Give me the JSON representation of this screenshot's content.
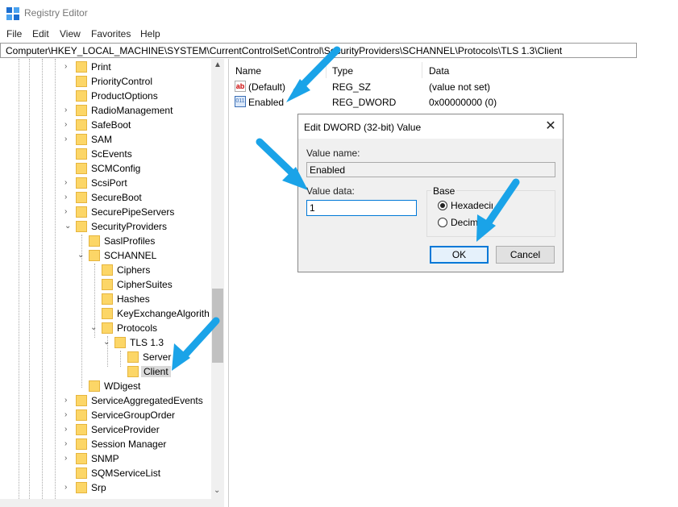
{
  "window": {
    "title": "Registry Editor"
  },
  "menu": [
    "File",
    "Edit",
    "View",
    "Favorites",
    "Help"
  ],
  "address": "Computer\\HKEY_LOCAL_MACHINE\\SYSTEM\\CurrentControlSet\\Control\\SecurityProviders\\SCHANNEL\\Protocols\\TLS 1.3\\Client",
  "tree": [
    {
      "label": "Print",
      "arrow": "›"
    },
    {
      "label": "PriorityControl",
      "arrow": ""
    },
    {
      "label": "ProductOptions",
      "arrow": ""
    },
    {
      "label": "RadioManagement",
      "arrow": "›"
    },
    {
      "label": "SafeBoot",
      "arrow": "›"
    },
    {
      "label": "SAM",
      "arrow": "›"
    },
    {
      "label": "ScEvents",
      "arrow": ""
    },
    {
      "label": "SCMConfig",
      "arrow": ""
    },
    {
      "label": "ScsiPort",
      "arrow": "›"
    },
    {
      "label": "SecureBoot",
      "arrow": "›"
    },
    {
      "label": "SecurePipeServers",
      "arrow": "›"
    },
    {
      "label": "SecurityProviders",
      "arrow": "⌄"
    },
    {
      "label": "SaslProfiles",
      "arrow": ""
    },
    {
      "label": "SCHANNEL",
      "arrow": "⌄"
    },
    {
      "label": "Ciphers",
      "arrow": ""
    },
    {
      "label": "CipherSuites",
      "arrow": ""
    },
    {
      "label": "Hashes",
      "arrow": ""
    },
    {
      "label": "KeyExchangeAlgorith",
      "arrow": ""
    },
    {
      "label": "Protocols",
      "arrow": "⌄"
    },
    {
      "label": "TLS 1.3",
      "arrow": "⌄"
    },
    {
      "label": "Server",
      "arrow": ""
    },
    {
      "label": "Client",
      "arrow": ""
    },
    {
      "label": "WDigest",
      "arrow": ""
    },
    {
      "label": "ServiceAggregatedEvents",
      "arrow": "›"
    },
    {
      "label": "ServiceGroupOrder",
      "arrow": "›"
    },
    {
      "label": "ServiceProvider",
      "arrow": "›"
    },
    {
      "label": "Session Manager",
      "arrow": "›"
    },
    {
      "label": "SNMP",
      "arrow": "›"
    },
    {
      "label": "SQMServiceList",
      "arrow": ""
    },
    {
      "label": "Srp",
      "arrow": "›"
    }
  ],
  "columns": {
    "name": "Name",
    "type": "Type",
    "data": "Data"
  },
  "values": [
    {
      "name": "(Default)",
      "type": "REG_SZ",
      "data": "(value not set)",
      "icon": "string-value-icon"
    },
    {
      "name": "Enabled",
      "type": "REG_DWORD",
      "data": "0x00000000 (0)",
      "icon": "dword-value-icon"
    }
  ],
  "dialog": {
    "title": "Edit DWORD (32-bit) Value",
    "value_name_label": "Value name:",
    "value_name": "Enabled",
    "value_data_label": "Value data:",
    "value_data": "1",
    "base_label": "Base",
    "hex_label": "Hexadecimal",
    "dec_label": "Decimal",
    "ok": "OK",
    "cancel": "Cancel"
  },
  "colors": {
    "arrow": "#1aa3e8",
    "folder": "#fcd667",
    "accent": "#0078d7"
  }
}
